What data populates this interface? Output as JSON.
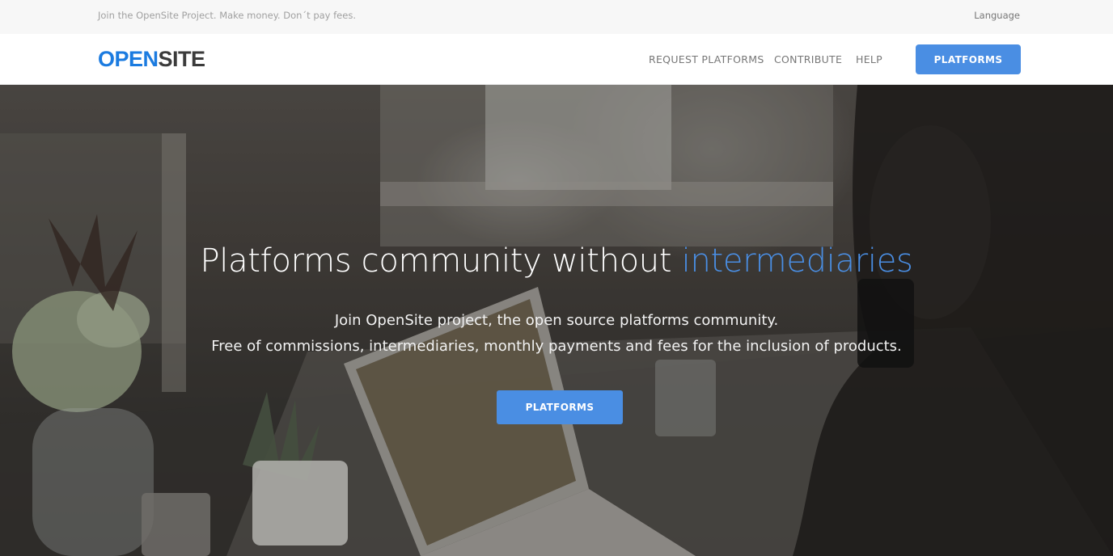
{
  "topbar": {
    "message": "Join the OpenSite Project. Make money. Don´t pay fees.",
    "language_label": "Language"
  },
  "navbar": {
    "logo_part1": "OPEN",
    "logo_part2": "SITE",
    "links": [
      {
        "label": "REQUEST PLATFORMS"
      },
      {
        "label": "CONTRIBUTE"
      },
      {
        "label": "HELP"
      }
    ],
    "cta_label": "PLATFORMS"
  },
  "hero": {
    "title_main": "Platforms community without ",
    "title_accent": "intermediaries",
    "subtitle_line1": "Join OpenSite project, the open source platforms community.",
    "subtitle_line2": "Free of commissions, intermediaries, monthly payments and fees for the inclusion of products.",
    "cta_label": "PLATFORMS"
  },
  "colors": {
    "accent": "#4a8ee3",
    "logo_blue": "#1b7be0",
    "logo_dark": "#3b3b3b"
  }
}
